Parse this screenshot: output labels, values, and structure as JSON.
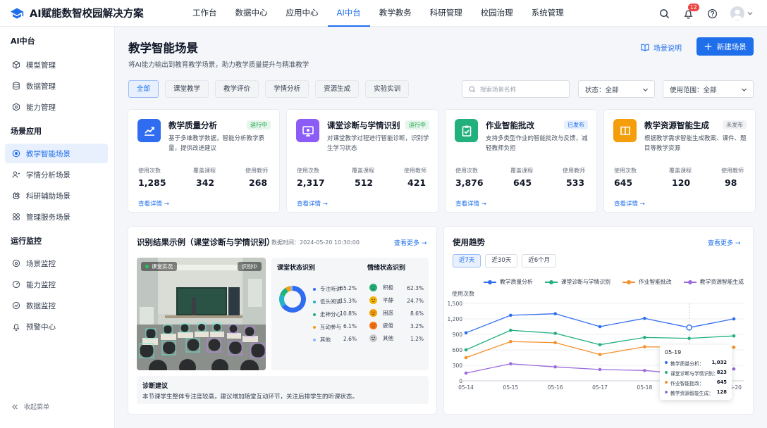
{
  "app": {
    "title": "AI赋能数智校园解决方案"
  },
  "nav": {
    "items": [
      "工作台",
      "数据中心",
      "应用中心",
      "AI中台",
      "教学教务",
      "科研管理",
      "校园治理",
      "系统管理"
    ],
    "active": "AI中台"
  },
  "header": {
    "notification_count": "12"
  },
  "sidebar": {
    "group1": "AI中台",
    "g1_items": [
      "模型管理",
      "数据管理",
      "能力管理"
    ],
    "group2": "场景应用",
    "g2_items": [
      "教学智能场景",
      "学情分析场景",
      "科研辅助场景",
      "管理服务场景"
    ],
    "group3": "运行监控",
    "g3_items": [
      "场景监控",
      "能力监控",
      "数据监控",
      "预警中心"
    ],
    "collapse": "收起菜单"
  },
  "page": {
    "title": "教学智能场景",
    "subtitle": "将AI能力输出到教育教学场景，助力教学质量提升与精准教学",
    "help_label": "场景说明",
    "new_label": "新建场景"
  },
  "filters": {
    "chips": [
      "全部",
      "课堂教学",
      "教学评价",
      "学情分析",
      "资源生成",
      "实验实训"
    ],
    "search_placeholder": "搜索场景名称",
    "status_select": "状态：全部",
    "scope_select": "使用范围：全部"
  },
  "cards": [
    {
      "title": "教学质量分析",
      "status": "运行中",
      "status_type": "run",
      "icon": "chart-up-icon",
      "color": "#2f6cf0",
      "desc": "基于多维教学数据，智能分析教学质量，提供改进建议",
      "l1": "使用次数",
      "v1": "1,285",
      "l2": "覆盖课程",
      "v2": "342",
      "l3": "使用教师",
      "v3": "268",
      "more": "查看详情"
    },
    {
      "title": "课堂诊断与学情识别",
      "status": "运行中",
      "status_type": "run",
      "icon": "monitor-icon",
      "color": "#8b5cf6",
      "desc": "对课堂教学过程进行智能诊断，识别学生学习状态",
      "l1": "使用次数",
      "v1": "2,317",
      "l2": "覆盖课程",
      "v2": "512",
      "l3": "使用教师",
      "v3": "421",
      "more": "查看详情"
    },
    {
      "title": "作业智能批改",
      "status": "已发布",
      "status_type": "pub",
      "icon": "clipboard-check-icon",
      "color": "#22b07d",
      "desc": "支持多类型作业的智能批改与反馈，减轻教师负担",
      "l1": "使用次数",
      "v1": "3,876",
      "l2": "覆盖课程",
      "v2": "645",
      "l3": "使用教师",
      "v3": "533",
      "more": "查看详情"
    },
    {
      "title": "教学资源智能生成",
      "status": "未发布",
      "status_type": "un",
      "icon": "book-icon",
      "color": "#f59e0b",
      "desc": "根据教学需求智能生成教案、课件、题目等教学资源",
      "l1": "使用次数",
      "v1": "645",
      "l2": "覆盖课程",
      "v2": "120",
      "l3": "使用教师",
      "v3": "98",
      "more": "查看详情"
    }
  ],
  "recognition": {
    "title": "识别结果示例（课堂诊断与学情识别）",
    "time": "数据时间：2024-05-20 10:30:00",
    "more": "查看更多",
    "photo_tag": "课堂实况",
    "photo_tag2": "识别中",
    "class_title": "课堂状态识别",
    "class_rows": [
      {
        "label": "专注听讲",
        "pct": "65.2%",
        "value": 65.2,
        "color": "#2f6cf0"
      },
      {
        "label": "低头阅读",
        "pct": "15.3%",
        "value": 15.3,
        "color": "#25b3c6"
      },
      {
        "label": "走神分心",
        "pct": "10.8%",
        "value": 10.8,
        "color": "#22b07d"
      },
      {
        "label": "互动参与",
        "pct": "6.1%",
        "value": 6.1,
        "color": "#f59e0b"
      },
      {
        "label": "其他",
        "pct": "2.6%",
        "value": 2.6,
        "color": "#8fb4f7"
      }
    ],
    "emo_title": "情绪状态识别",
    "emo_rows": [
      {
        "label": "积极",
        "pct": "62.3%",
        "color": "#22b07d",
        "icon": "smile-icon"
      },
      {
        "label": "平静",
        "pct": "24.7%",
        "color": "#f5b400",
        "icon": "neutral-face-icon"
      },
      {
        "label": "困惑",
        "pct": "8.6%",
        "color": "#f59e0b",
        "icon": "confused-face-icon"
      },
      {
        "label": "疲倦",
        "pct": "3.2%",
        "color": "#f97316",
        "icon": "tired-face-icon"
      },
      {
        "label": "其他",
        "pct": "1.2%",
        "color": "#c4c8cf",
        "icon": "other-face-icon"
      }
    ],
    "suggest_title": "诊断建议",
    "suggest_text": "本节课学生整体专注度较高，建议增加随堂互动环节，关注后排学生的听课状态。"
  },
  "trend": {
    "title": "使用趋势",
    "more": "查看更多",
    "ranges": [
      "近7天",
      "近30天",
      "近6个月"
    ],
    "active_range": "近7天",
    "tooltip": {
      "date": "05-19",
      "rows": [
        {
          "label": "教学质量分析：",
          "value": "1,032"
        },
        {
          "label": "课堂诊断与学情识别：",
          "value": "823"
        },
        {
          "label": "作业智能批改：",
          "value": "645"
        },
        {
          "label": "教学资源智能生成：",
          "value": "128"
        }
      ]
    }
  },
  "chart_data": {
    "type": "line",
    "ylabel": "使用次数",
    "ylim": [
      0,
      1500
    ],
    "yticks": [
      "0",
      "300",
      "600",
      "900",
      "1,200",
      "1,500"
    ],
    "x": [
      "05-14",
      "05-15",
      "05-16",
      "05-17",
      "05-18",
      "05-19",
      "05-20"
    ],
    "series": [
      {
        "name": "教学质量分析",
        "color": "#2f6cf0",
        "values": [
          930,
          1270,
          1300,
          1050,
          1210,
          1032,
          1200
        ]
      },
      {
        "name": "课堂诊断与学情识别",
        "color": "#22b07d",
        "values": [
          600,
          980,
          920,
          700,
          840,
          823,
          870
        ]
      },
      {
        "name": "作业智能批改",
        "color": "#f5902a",
        "values": [
          450,
          760,
          740,
          510,
          660,
          645,
          650
        ]
      },
      {
        "name": "教学资源智能生成",
        "color": "#9b6bdc",
        "values": [
          150,
          330,
          270,
          220,
          200,
          128,
          230
        ]
      }
    ],
    "grid": true,
    "legend": "top"
  }
}
